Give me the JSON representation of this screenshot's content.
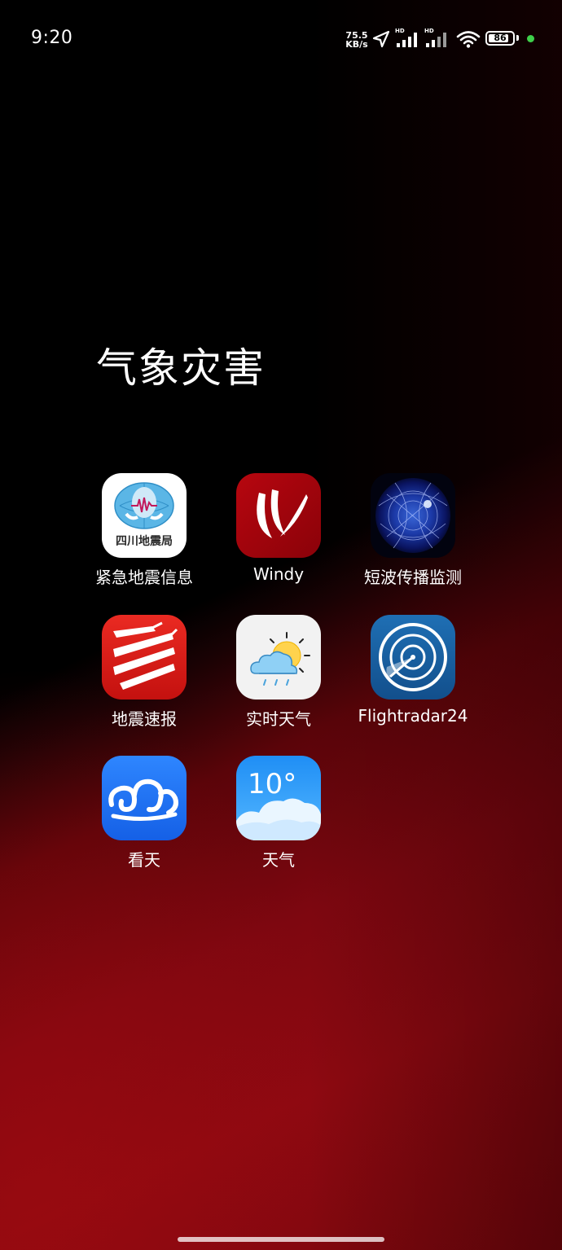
{
  "status_bar": {
    "time": "9:20",
    "net_speed_value": "75.5",
    "net_speed_unit": "KB/s",
    "sim1_tag": "HD",
    "sim2_tag": "HD",
    "battery_level": 86,
    "battery_text": "86",
    "icons": [
      "location-arrow-icon",
      "signal-icon",
      "signal-icon",
      "wifi-icon",
      "battery-icon",
      "privacy-indicator-dot"
    ]
  },
  "folder": {
    "title": "气象灾害",
    "apps": [
      {
        "label": "紧急地震信息",
        "icon": "sichuan-earthquake-bureau-icon",
        "icon_text": "四川地震局"
      },
      {
        "label": "Windy",
        "icon": "windy-icon"
      },
      {
        "label": "短波传播监测",
        "icon": "sun-magnetic-field-icon"
      },
      {
        "label": "地震速报",
        "icon": "earthquake-report-icon"
      },
      {
        "label": "实时天气",
        "icon": "sun-cloud-weather-icon"
      },
      {
        "label": "Flightradar24",
        "icon": "radar-icon"
      },
      {
        "label": "看天",
        "icon": "waves-cloud-icon"
      },
      {
        "label": "天气",
        "icon": "weather-cloud-icon",
        "icon_text": "10°"
      }
    ]
  },
  "colors": {
    "accent_green": "#3ecf4a",
    "wallpaper_red": "#8e0911"
  }
}
